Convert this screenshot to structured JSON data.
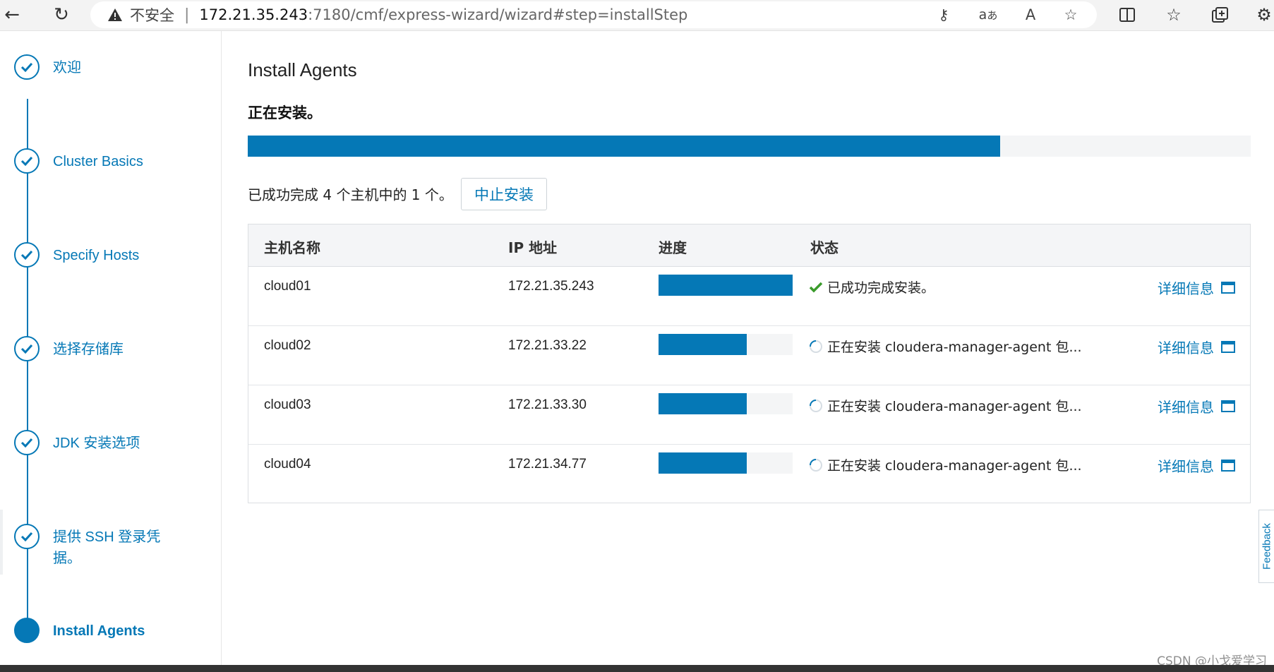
{
  "browser": {
    "insecure_label": "不安全",
    "url_host": "172.21.35.243",
    "url_path": ":7180/cmf/express-wizard/wizard#step=installStep"
  },
  "sidebar": {
    "steps": [
      {
        "label": "欢迎",
        "state": "done"
      },
      {
        "label": "Cluster Basics",
        "state": "done"
      },
      {
        "label": "Specify Hosts",
        "state": "done"
      },
      {
        "label": "选择存储库",
        "state": "done"
      },
      {
        "label": "JDK 安装选项",
        "state": "done"
      },
      {
        "label": "提供 SSH 登录凭据。",
        "state": "done"
      },
      {
        "label": "Install Agents",
        "state": "active"
      }
    ]
  },
  "main": {
    "title": "Install Agents",
    "status_heading": "正在安装。",
    "overall_progress": 0.75,
    "summary": "已成功完成 4 个主机中的 1 个。",
    "abort_label": "中止安装"
  },
  "table": {
    "columns": [
      "主机名称",
      "IP 地址",
      "进度",
      "状态"
    ],
    "details_label": "详细信息",
    "rows": [
      {
        "host": "cloud01",
        "ip": "172.21.35.243",
        "progress": 1.0,
        "status": "已成功完成安装。",
        "state": "done"
      },
      {
        "host": "cloud02",
        "ip": "172.21.33.22",
        "progress": 0.66,
        "status": "正在安装 cloudera-manager-agent 包...",
        "state": "installing"
      },
      {
        "host": "cloud03",
        "ip": "172.21.33.30",
        "progress": 0.66,
        "status": "正在安装 cloudera-manager-agent 包...",
        "state": "installing"
      },
      {
        "host": "cloud04",
        "ip": "172.21.34.77",
        "progress": 0.66,
        "status": "正在安装 cloudera-manager-agent 包...",
        "state": "installing"
      }
    ]
  },
  "feedback_label": "Feedback",
  "watermark": "CSDN @小戈爱学习",
  "colors": {
    "accent": "#0578b6",
    "success": "#3a9b2b"
  }
}
